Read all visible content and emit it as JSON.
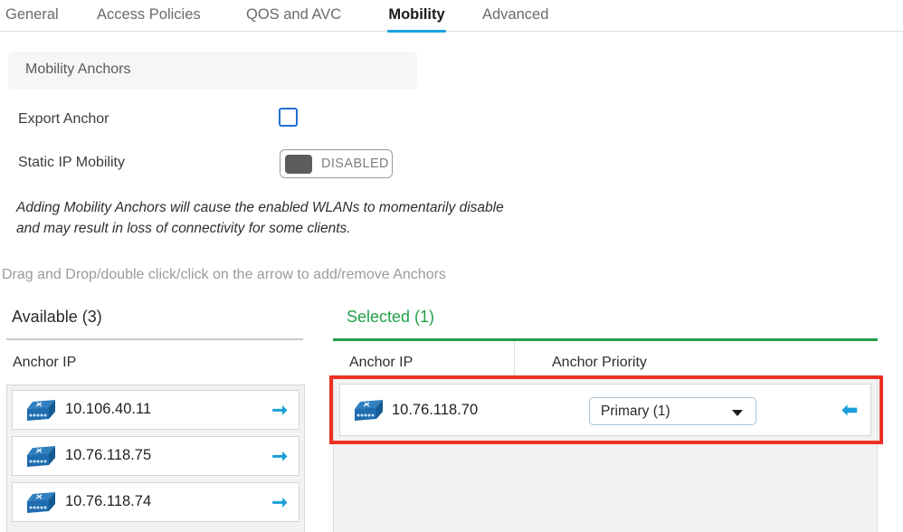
{
  "tabs": [
    {
      "label": "General",
      "active": false
    },
    {
      "label": "Access Policies",
      "active": false
    },
    {
      "label": "QOS and AVC",
      "active": false
    },
    {
      "label": "Mobility",
      "active": true
    },
    {
      "label": "Advanced",
      "active": false
    }
  ],
  "panel": {
    "title": "Mobility Anchors"
  },
  "form": {
    "export_anchor_label": "Export Anchor",
    "export_anchor_checked": false,
    "static_ip_label": "Static IP Mobility",
    "static_ip_state": "DISABLED"
  },
  "notice": "Adding Mobility Anchors will cause the enabled WLANs to momentarily disable and may result in loss of connectivity for some clients.",
  "hint": "Drag and Drop/double click/click on the arrow to add/remove Anchors",
  "available": {
    "title": "Available (3)",
    "column_header": "Anchor IP",
    "rows": [
      {
        "ip": "10.106.40.11"
      },
      {
        "ip": "10.76.118.75"
      },
      {
        "ip": "10.76.118.74"
      }
    ]
  },
  "selected": {
    "title": "Selected (1)",
    "column_header_ip": "Anchor IP",
    "column_header_priority": "Anchor Priority",
    "rows": [
      {
        "ip": "10.76.118.70",
        "priority": "Primary (1)"
      }
    ]
  },
  "colors": {
    "active_tab_underline": "#1aa1e1",
    "selected_accent": "#22a04a",
    "highlight_box": "#ee3124",
    "arrow": "#1b9ed8",
    "checkbox_border": "#1f6fd0"
  }
}
